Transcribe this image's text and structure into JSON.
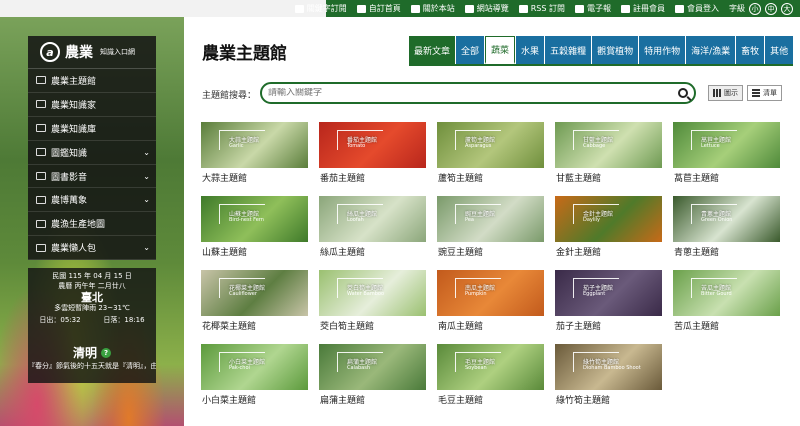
{
  "topbar": {
    "items": [
      "關鍵字訂閱",
      "自訂首頁",
      "關於本站",
      "網站導覽",
      "RSS 訂閱",
      "電子報",
      "註冊會員",
      "會員登入"
    ],
    "font_label": "字級",
    "font_sizes": [
      "小",
      "中",
      "大"
    ]
  },
  "logo": {
    "mark": "a",
    "name": "農業",
    "sub": "知識入口網"
  },
  "sidebar": {
    "items": [
      {
        "label": "農業主題館",
        "icon": "book-icon",
        "expand": false
      },
      {
        "label": "農業知識家",
        "icon": "people-icon",
        "expand": false
      },
      {
        "label": "農業知識庫",
        "icon": "monitor-icon",
        "expand": false
      },
      {
        "label": "圖鑑知識",
        "icon": "picture-icon",
        "expand": true
      },
      {
        "label": "圖書影音",
        "icon": "video-icon",
        "expand": true
      },
      {
        "label": "農博萬象",
        "icon": "globe-icon",
        "expand": true
      },
      {
        "label": "農漁生產地圖",
        "icon": "leaf-icon",
        "expand": false
      },
      {
        "label": "農業懶人包",
        "icon": "package-icon",
        "expand": true
      }
    ]
  },
  "weather": {
    "date": "民國 115 年 04 月 15 日",
    "lunar": "農曆 丙午年 二月廿八",
    "city": "臺北",
    "forecast": "多雲短暫陣雨 23~31℃",
    "sunrise": "日出：05:32",
    "sunset": "日落：18:16"
  },
  "solar_term": {
    "name": "清明",
    "badge": "?",
    "desc": "『春分』節氣後的十五天就是『清明』，由於天氣日漸晴和，花草樹木都"
  },
  "main": {
    "title": "農業主題館",
    "tabs": [
      {
        "label": "最新文章",
        "style": "green"
      },
      {
        "label": "全部",
        "style": "blue"
      },
      {
        "label": "蔬菜",
        "style": "active"
      },
      {
        "label": "水果",
        "style": "blue"
      },
      {
        "label": "五穀雜糧",
        "style": "blue"
      },
      {
        "label": "觀賞植物",
        "style": "blue"
      },
      {
        "label": "特用作物",
        "style": "blue"
      },
      {
        "label": "海洋/漁業",
        "style": "blue"
      },
      {
        "label": "畜牧",
        "style": "blue"
      },
      {
        "label": "其他",
        "style": "blue"
      }
    ],
    "search_label": "主題館搜尋：",
    "search_placeholder": "請輸入關鍵字",
    "view_grid": "圖示",
    "view_list": "清單"
  },
  "cards": [
    {
      "caption": "大蒜主題館",
      "frame": "大蒜主題館",
      "en": "Garlic",
      "colors": [
        "#5a7d3a",
        "#c9d8a8"
      ]
    },
    {
      "caption": "番茄主題館",
      "frame": "番茄主題館",
      "en": "Tomato",
      "colors": [
        "#b8261c",
        "#e54a2c"
      ]
    },
    {
      "caption": "蘆筍主題館",
      "frame": "蘆筍主題館",
      "en": "Asparagus",
      "colors": [
        "#6f8f3c",
        "#b3c67c"
      ]
    },
    {
      "caption": "甘藍主題館",
      "frame": "甘藍主題館",
      "en": "Cabbage",
      "colors": [
        "#6e9a52",
        "#cfe0b0"
      ]
    },
    {
      "caption": "萵苣主題館",
      "frame": "萵苣主題館",
      "en": "Lettuce",
      "colors": [
        "#4f8a3a",
        "#a6cf7a"
      ]
    },
    {
      "caption": "山蘇主題館",
      "frame": "山蘇主題館",
      "en": "Bird-nest Fern",
      "colors": [
        "#3f7a2a",
        "#8fbf5a"
      ]
    },
    {
      "caption": "絲瓜主題館",
      "frame": "絲瓜主題館",
      "en": "Loofah",
      "colors": [
        "#8ba67a",
        "#d7e2c8"
      ]
    },
    {
      "caption": "豌豆主題館",
      "frame": "豌豆主題館",
      "en": "Pea",
      "colors": [
        "#7a9a6a",
        "#d2dcc6"
      ]
    },
    {
      "caption": "金針主題館",
      "frame": "金針主題館",
      "en": "Daylily",
      "colors": [
        "#c86a18",
        "#4f7a2a"
      ]
    },
    {
      "caption": "青蔥主題館",
      "frame": "青蔥主題館",
      "en": "Green Onion",
      "colors": [
        "#3a5a2c",
        "#d8e4d0"
      ]
    },
    {
      "caption": "花椰菜主題館",
      "frame": "花椰菜主題館",
      "en": "Cauliflower",
      "colors": [
        "#c8c4a8",
        "#5e7e42"
      ]
    },
    {
      "caption": "茭白筍主題館",
      "frame": "茭白筍主題館",
      "en": "Water Bamboo",
      "colors": [
        "#9ac070",
        "#e6eedb"
      ]
    },
    {
      "caption": "南瓜主題館",
      "frame": "南瓜主題館",
      "en": "Pumpkin",
      "colors": [
        "#c25a1c",
        "#e88838"
      ]
    },
    {
      "caption": "茄子主題館",
      "frame": "茄子主題館",
      "en": "Eggplant",
      "colors": [
        "#3a2a48",
        "#6a5a7a"
      ]
    },
    {
      "caption": "苦瓜主題館",
      "frame": "苦瓜主題館",
      "en": "Bitter Gourd",
      "colors": [
        "#6aa04a",
        "#c8e0b0"
      ]
    },
    {
      "caption": "小白菜主題館",
      "frame": "小白菜主題館",
      "en": "Pak-choi",
      "colors": [
        "#5c9a3c",
        "#b0d690"
      ]
    },
    {
      "caption": "扁蒲主題館",
      "frame": "扁蒲主題館",
      "en": "Calabash",
      "colors": [
        "#4a7a3a",
        "#9ab87a"
      ]
    },
    {
      "caption": "毛豆主題館",
      "frame": "毛豆主題館",
      "en": "Soybean",
      "colors": [
        "#5a8a3a",
        "#aed080"
      ]
    },
    {
      "caption": "綠竹筍主題館",
      "frame": "綠竹筍主題館",
      "en": "Dioham Bamboo Shoot",
      "colors": [
        "#6a5a3a",
        "#c8b890"
      ]
    }
  ]
}
